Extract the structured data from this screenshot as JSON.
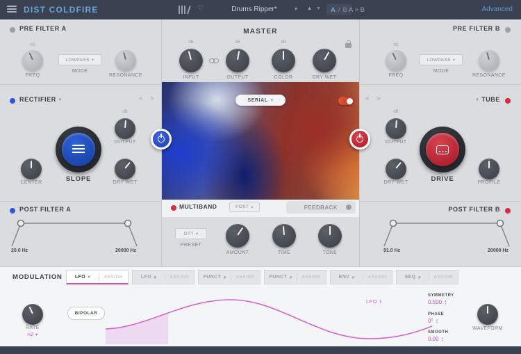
{
  "header": {
    "title": "DIST COLDFIRE",
    "preset": "Drums Ripper*",
    "a_label": "A",
    "ab_sep": "/",
    "b_label": "B",
    "a_to_b": "A > B",
    "advanced": "Advanced"
  },
  "colors": {
    "accent_blue": "#68a4da",
    "magenta": "#cf52cc",
    "led_red": "#d8293e",
    "led_blue": "#2b55e2",
    "big_knob_blue": "#1e4fc0",
    "big_knob_red": "#c01d30"
  },
  "pre_filter_a": {
    "title": "PRE FILTER A",
    "freq_label": "FREQ",
    "freq_unit": "Hz",
    "mode_value": "LOWPASS",
    "mode_label": "MODE",
    "resonance_label": "RESONANCE"
  },
  "rectifier": {
    "title": "RECTIFIER",
    "output_unit": "dB",
    "output_label": "OUTPUT",
    "slope_label": "SLOPE",
    "center_label": "CENTER",
    "drywet_label": "DRY WET"
  },
  "post_filter_a": {
    "title": "POST FILTER A",
    "low_value": "20.0 Hz",
    "high_value": "20000 Hz"
  },
  "master": {
    "title": "MASTER",
    "input_label": "INPUT",
    "input_unit": "dB",
    "output_label": "OUTPUT",
    "output_unit": "dB",
    "color_label": "COLOR",
    "color_unit": "dB",
    "drywet_label": "DRY WET",
    "routing_value": "SERIAL"
  },
  "multiband": {
    "title": "MULTIBAND",
    "post_value": "POST",
    "feedback_label": "FEEDBACK",
    "preset_value": "OTT",
    "preset_label": "PRESET",
    "amount_label": "AMOUNT",
    "time_label": "TIME",
    "tone_label": "TONE"
  },
  "pre_filter_b": {
    "title": "PRE FILTER B",
    "freq_label": "FREQ",
    "freq_unit": "Hz",
    "mode_value": "LOWPASS",
    "mode_label": "MODE",
    "resonance_label": "RESONANCE"
  },
  "tube": {
    "title": "TUBE",
    "output_label": "OUTPUT",
    "output_unit": "dB",
    "drive_label": "DRIVE",
    "drywet_label": "DRY WET",
    "profile_label": "PROFILE"
  },
  "post_filter_b": {
    "title": "POST FILTER B",
    "low_value": "91.0 Hz",
    "high_value": "20000 Hz"
  },
  "modulation": {
    "title": "MODULATION",
    "tabs": [
      {
        "type": "LFO",
        "assign": "ASSIGN",
        "selected": true
      },
      {
        "type": "LFO",
        "assign": "ASSIGN",
        "selected": false
      },
      {
        "type": "FUNCT",
        "assign": "ASSIGN",
        "selected": false
      },
      {
        "type": "FUNCT",
        "assign": "ASSIGN",
        "selected": false
      },
      {
        "type": "ENV",
        "assign": "ASSIGN",
        "selected": false
      },
      {
        "type": "SEQ",
        "assign": "ASSIGN",
        "selected": false
      }
    ],
    "rate_label": "RATE",
    "rate_unit": "HZ",
    "bipolar_label": "BIPOLAR",
    "lfo_name": "LFO 1",
    "symmetry_label": "SYMMETRY",
    "symmetry_value": "0.500",
    "phase_label": "PHASE",
    "phase_value": "0°",
    "smooth_label": "SMOOTH",
    "smooth_value": "0.00",
    "waveform_label": "WAVEFORM"
  }
}
